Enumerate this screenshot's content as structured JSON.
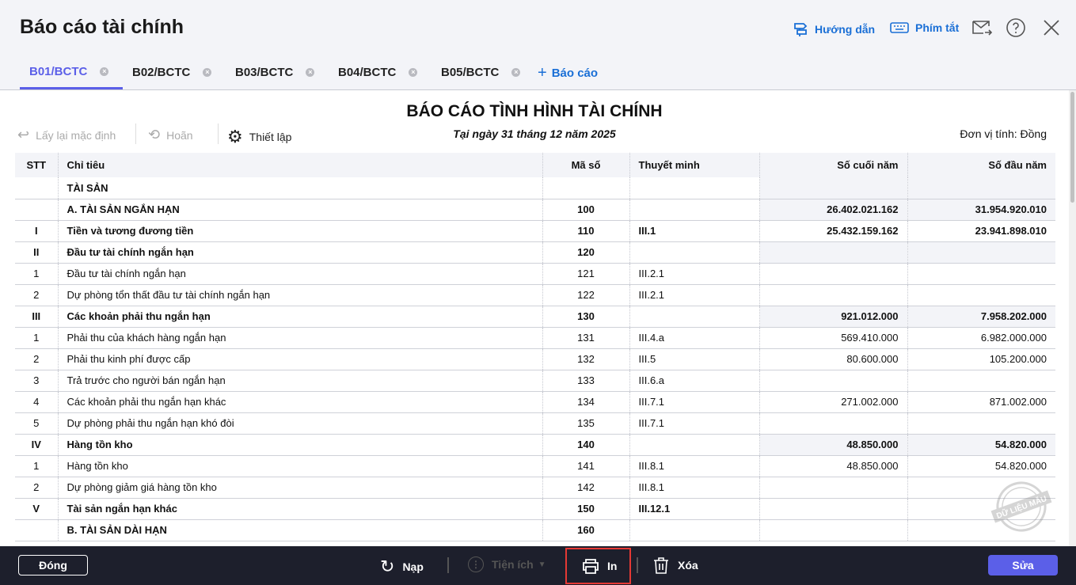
{
  "header": {
    "title": "Báo cáo tài chính",
    "guide": "Hướng dẫn",
    "shortcuts": "Phím tắt"
  },
  "tabs": [
    {
      "label": "B01/BCTC",
      "active": true
    },
    {
      "label": "B02/BCTC"
    },
    {
      "label": "B03/BCTC"
    },
    {
      "label": "B04/BCTC"
    },
    {
      "label": "B05/BCTC"
    }
  ],
  "add_report": "Báo cáo",
  "toolbar": {
    "reset": "Lấy lại mặc định",
    "undo": "Hoãn",
    "settings": "Thiết lập"
  },
  "report": {
    "title": "BÁO CÁO TÌNH HÌNH TÀI CHÍNH",
    "date": "Tại ngày 31 tháng 12 năm 2025",
    "unit": "Đơn vị tính: Đồng",
    "watermark": "DỮ LIỆU MẪU"
  },
  "columns": [
    "STT",
    "Chỉ tiêu",
    "Mã số",
    "Thuyết minh",
    "Số cuối năm",
    "Số đầu năm"
  ],
  "rows": [
    [
      "",
      "TÀI SẢN",
      "",
      "",
      "",
      ""
    ],
    [
      "",
      "A. TÀI SẢN NGẮN HẠN",
      "100",
      "",
      "26.402.021.162",
      "31.954.920.010"
    ],
    [
      "I",
      "Tiền và tương đương tiền",
      "110",
      "III.1",
      "25.432.159.162",
      "23.941.898.010"
    ],
    [
      "II",
      "Đầu tư tài chính ngắn hạn",
      "120",
      "",
      "",
      ""
    ],
    [
      "1",
      "Đầu tư tài chính ngắn hạn",
      "121",
      "III.2.1",
      "",
      ""
    ],
    [
      "2",
      "Dự phòng tổn thất đầu tư tài chính ngắn hạn",
      "122",
      "III.2.1",
      "",
      ""
    ],
    [
      "III",
      "Các khoản phải thu ngắn hạn",
      "130",
      "",
      "921.012.000",
      "7.958.202.000"
    ],
    [
      "1",
      "Phải thu của khách hàng ngắn hạn",
      "131",
      "III.4.a",
      "569.410.000",
      "6.982.000.000"
    ],
    [
      "2",
      "Phải thu kinh phí được cấp",
      "132",
      "III.5",
      "80.600.000",
      "105.200.000"
    ],
    [
      "3",
      "Trả trước cho người bán ngắn hạn",
      "133",
      "III.6.a",
      "",
      ""
    ],
    [
      "4",
      "Các khoản phải thu ngắn hạn khác",
      "134",
      "III.7.1",
      "271.002.000",
      "871.002.000"
    ],
    [
      "5",
      "Dự phòng phải thu ngắn hạn khó đòi",
      "135",
      "III.7.1",
      "",
      ""
    ],
    [
      "IV",
      "Hàng tồn kho",
      "140",
      "",
      "48.850.000",
      "54.820.000"
    ],
    [
      "1",
      "Hàng tồn kho",
      "141",
      "III.8.1",
      "48.850.000",
      "54.820.000"
    ],
    [
      "2",
      "Dự phòng giảm giá hàng tồn kho",
      "142",
      "III.8.1",
      "",
      ""
    ],
    [
      "V",
      "Tài sản ngắn hạn khác",
      "150",
      "III.12.1",
      "",
      ""
    ],
    [
      "",
      "B. TÀI SẢN DÀI HẠN",
      "160",
      "",
      "",
      ""
    ]
  ],
  "bold_rows": [
    0,
    1,
    2,
    3,
    6,
    12,
    15,
    16
  ],
  "calc_rows": [
    0,
    1,
    3,
    6,
    12
  ],
  "footer": {
    "close": "Đóng",
    "reload": "Nạp",
    "utilities": "Tiện ích",
    "print": "In",
    "delete": "Xóa",
    "edit": "Sửa"
  },
  "colors": {
    "accent": "#5b5fe8",
    "link": "#1a6fd6",
    "footer_bg": "#1d1f2c",
    "highlight": "#e53935"
  }
}
